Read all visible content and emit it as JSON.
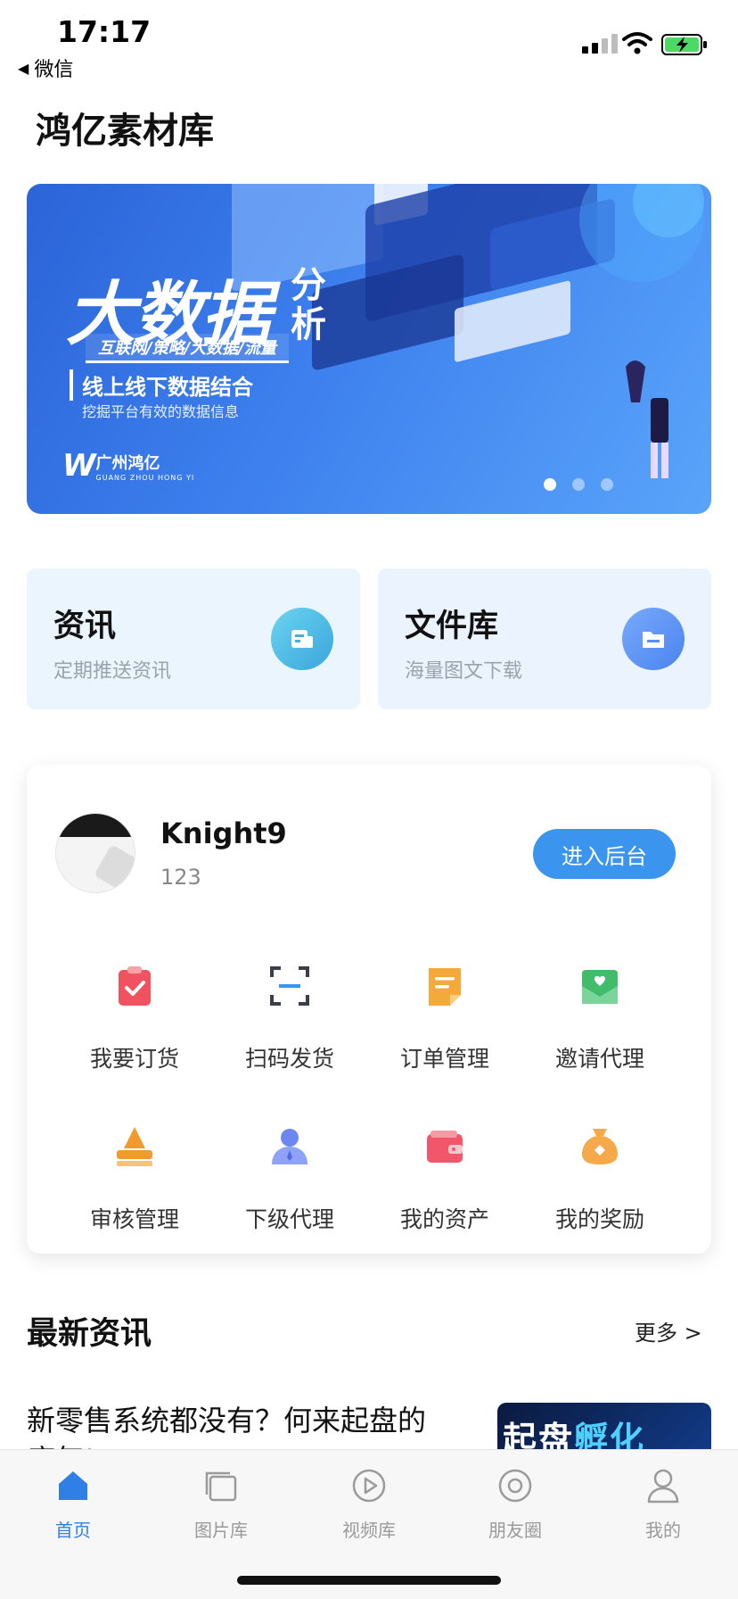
{
  "status_bar": {
    "time": "17:17",
    "back_label": "微信"
  },
  "app": {
    "title": "鸿亿素材库"
  },
  "banner": {
    "title_main": "大数据",
    "title_side": "分析",
    "tags": "互联网/策略/大数据/流量",
    "subtitle": "线上线下数据结合",
    "caption": "挖掘平台有效的数据信息",
    "logo_cn": "广州鸿亿",
    "logo_en": "GUANG ZHOU HONG YI",
    "slide_count": 3,
    "active_slide": 1
  },
  "features": [
    {
      "title": "资讯",
      "subtitle": "定期推送资讯",
      "icon": "news-icon"
    },
    {
      "title": "文件库",
      "subtitle": "海量图文下载",
      "icon": "folder-icon"
    }
  ],
  "user": {
    "name": "Knight9",
    "id": "123",
    "enter_button": "进入后台"
  },
  "actions": [
    {
      "label": "我要订货",
      "icon": "order-clipboard-icon",
      "color": "#f0525f"
    },
    {
      "label": "扫码发货",
      "icon": "scan-icon",
      "color": "#3a3f4b"
    },
    {
      "label": "订单管理",
      "icon": "order-list-icon",
      "color": "#f5a93a"
    },
    {
      "label": "邀请代理",
      "icon": "invite-mail-icon",
      "color": "#3fbd6a"
    },
    {
      "label": "审核管理",
      "icon": "review-stamp-icon",
      "color": "#f39a2c"
    },
    {
      "label": "下级代理",
      "icon": "agent-user-icon",
      "color": "#6c86f2"
    },
    {
      "label": "我的资产",
      "icon": "wallet-icon",
      "color": "#f2566a"
    },
    {
      "label": "我的奖励",
      "icon": "reward-bag-icon",
      "color": "#f5a94a"
    }
  ],
  "news": {
    "header": "最新资讯",
    "more": "更多 >",
    "first_title": "新零售系统都没有？何来起盘的底气!",
    "thumb_text_a": "起盘",
    "thumb_text_b": "孵化"
  },
  "tabs": [
    {
      "label": "首页",
      "icon": "home-icon",
      "active": true
    },
    {
      "label": "图片库",
      "icon": "image-library-icon",
      "active": false
    },
    {
      "label": "视频库",
      "icon": "video-play-icon",
      "active": false
    },
    {
      "label": "朋友圈",
      "icon": "moments-icon",
      "active": false
    },
    {
      "label": "我的",
      "icon": "profile-icon",
      "active": false
    }
  ],
  "colors": {
    "accent": "#2f7fe6",
    "button": "#3b95ee"
  }
}
